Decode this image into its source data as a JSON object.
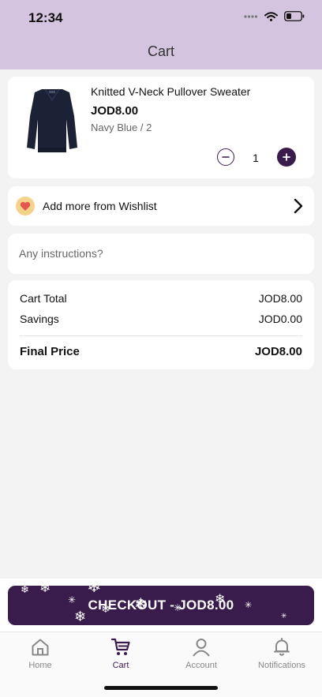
{
  "status_bar": {
    "time": "12:34"
  },
  "header": {
    "title": "Cart"
  },
  "cart_item": {
    "name": "Knitted V-Neck Pullover Sweater",
    "price": "JOD8.00",
    "variant": "Navy Blue / 2",
    "quantity": "1",
    "image_icon": "sweater-image"
  },
  "wishlist": {
    "label": "Add more from Wishlist",
    "icon": "heart-icon"
  },
  "instructions": {
    "placeholder": "Any instructions?",
    "value": ""
  },
  "summary": {
    "cart_total_label": "Cart Total",
    "cart_total_value": "JOD8.00",
    "savings_label": "Savings",
    "savings_value": "JOD0.00",
    "final_label": "Final Price",
    "final_value": "JOD8.00"
  },
  "checkout": {
    "label": "CHECKOUT - JOD8.00"
  },
  "tabs": [
    {
      "label": "Home",
      "icon": "home-icon",
      "active": false
    },
    {
      "label": "Cart",
      "icon": "cart-icon",
      "active": true
    },
    {
      "label": "Account",
      "icon": "account-icon",
      "active": false
    },
    {
      "label": "Notifications",
      "icon": "bell-icon",
      "active": false
    }
  ],
  "colors": {
    "header_bg": "#d4c4e0",
    "accent": "#3a1c4c",
    "background": "#f3f3f4",
    "heart": "#e5584f",
    "heart_bg": "#f4d38a"
  }
}
